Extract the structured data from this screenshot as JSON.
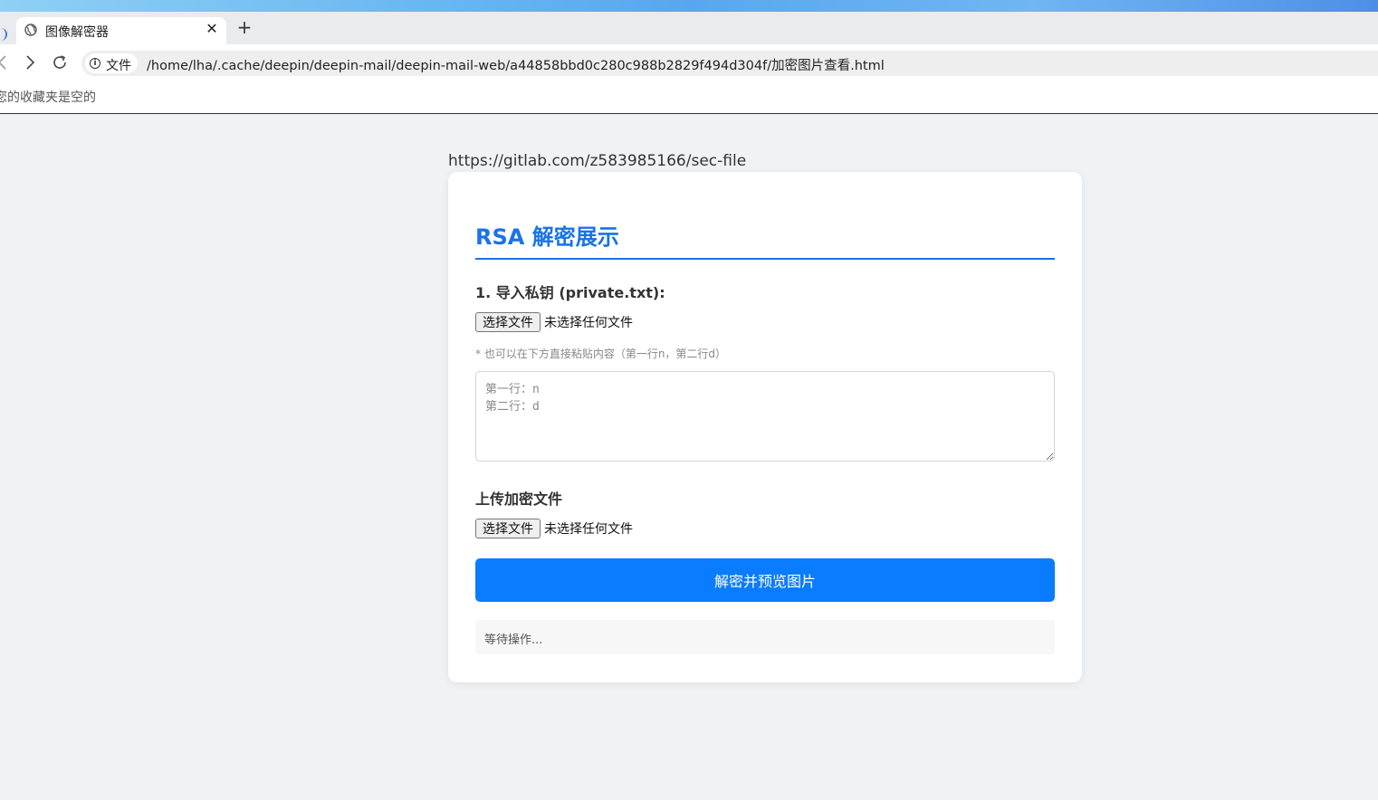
{
  "browser": {
    "tab_title": "图像解密器",
    "tab_close": "✕",
    "new_tab": "+",
    "address_chip": "文件",
    "url": "/home/lha/.cache/deepin/deepin-mail/deepin-mail-web/a44858bbd0c280c988b2829f494d304f/加密图片查看.html",
    "bookmarks_empty": "您的收藏夹是空的"
  },
  "page": {
    "source_link": "https://gitlab.com/z583985166/sec-file",
    "title": "RSA 解密展示",
    "key_section_label": "1. 导入私钥 (private.txt):",
    "key_file_button": "选择文件",
    "key_file_status": "未选择任何文件",
    "key_hint": "* 也可以在下方直接粘贴内容（第一行n，第二行d）",
    "key_textarea_placeholder": "第一行：n\n第二行：d",
    "upload_section_label": "上传加密文件",
    "upload_file_button": "选择文件",
    "upload_file_status": "未选择任何文件",
    "decrypt_button": "解密并预览图片",
    "status_text": "等待操作..."
  },
  "colors": {
    "accent": "#1a73e8",
    "primary_button": "#0a7cff",
    "page_background": "#f0f2f5"
  }
}
